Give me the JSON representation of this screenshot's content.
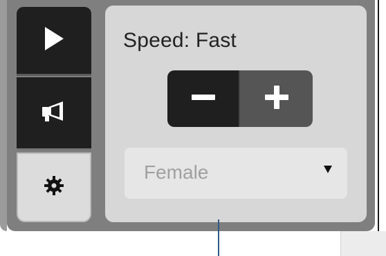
{
  "speed": {
    "label": "Speed: Fast"
  },
  "voice": {
    "selected": "Female"
  },
  "icons": {
    "play": "play-icon",
    "speak": "megaphone-icon",
    "settings": "gear-icon",
    "minus": "minus-icon",
    "plus": "plus-icon",
    "dropdown": "chevron-down-icon"
  },
  "colors": {
    "dark_button": "#1f1f1f",
    "mid_button": "#555555",
    "panel_bg": "#d7d7d7",
    "frame_bg": "#7f7f7f"
  }
}
